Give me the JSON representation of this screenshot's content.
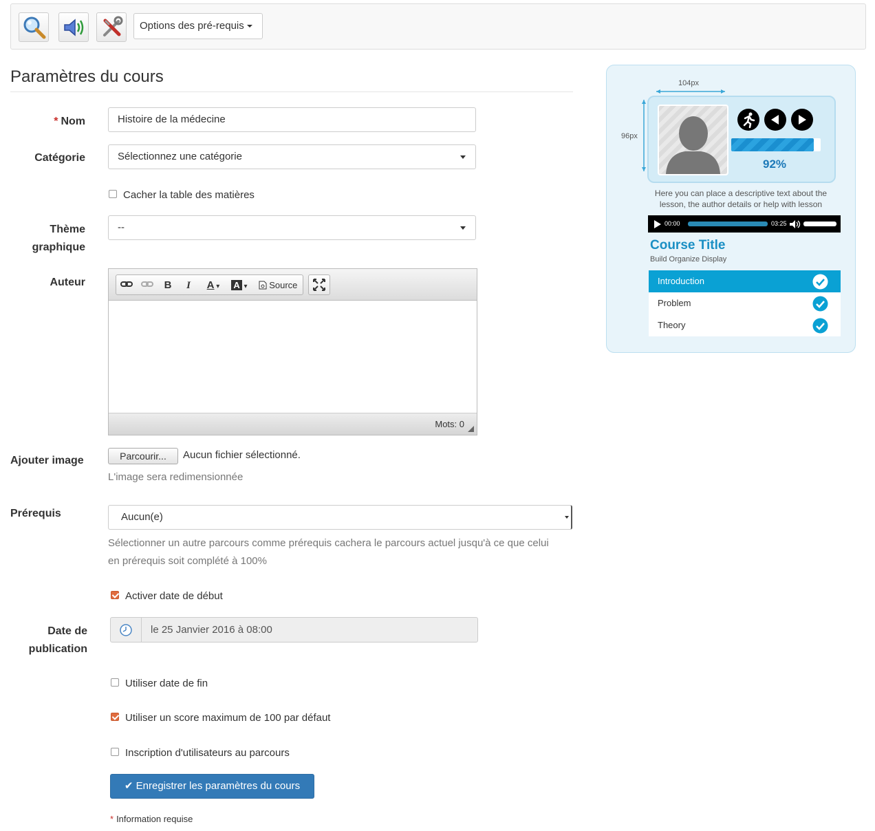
{
  "toolbar": {
    "buttons": [
      {
        "icon": "search-icon"
      },
      {
        "icon": "speaker-icon"
      },
      {
        "icon": "tools-icon"
      }
    ],
    "prereq_options_label": "Options des pré-requis"
  },
  "page_title": "Paramètres du cours",
  "form": {
    "name": {
      "label": "Nom",
      "value": "Histoire de la médecine"
    },
    "category": {
      "label": "Catégorie",
      "value": "Sélectionnez une catégorie"
    },
    "hide_toc": {
      "label": "Cacher la table des matières",
      "checked": false
    },
    "theme": {
      "label_line1": "Thème",
      "label_line2": "graphique",
      "value": "--"
    },
    "author": {
      "label": "Auteur",
      "source_label": "Source",
      "words_label": "Mots: 0"
    },
    "image": {
      "label": "Ajouter image",
      "browse_label": "Parcourir...",
      "no_file": "Aucun fichier sélectionné.",
      "help": "L'image sera redimensionnée"
    },
    "prereq": {
      "label": "Prérequis",
      "value": "Aucun(e)",
      "help_line1": "Sélectionner un autre parcours comme prérequis cachera le parcours actuel jusqu'à ce que celui",
      "help_line2": "en prérequis soit complété à 100%"
    },
    "enable_start_date": {
      "label": "Activer date de début",
      "checked": true
    },
    "publication_date": {
      "label_line1": "Date de",
      "label_line2": "publication",
      "value": "le 25 Janvier 2016 à 08:00"
    },
    "use_end_date": {
      "label": "Utiliser date de fin",
      "checked": false
    },
    "max_score": {
      "label": "Utiliser un score maximum de 100 par défaut",
      "checked": true
    },
    "subscribe_users": {
      "label": "Inscription d'utilisateurs au parcours",
      "checked": false
    },
    "submit_label": "Enregistrer les paramètres du cours",
    "required_note": "Information requise"
  },
  "preview": {
    "width_label": "104px",
    "height_label": "96px",
    "progress_percent": 92,
    "progress_label": "92%",
    "description": "Here you can place a descriptive text about the lesson, the author details or help with lesson",
    "player_start": "00:00",
    "player_end": "03:25",
    "course_title": "Course Title",
    "course_subtitle": "Build Organize Display",
    "items": [
      {
        "label": "Introduction",
        "active": true
      },
      {
        "label": "Problem",
        "active": false
      },
      {
        "label": "Theory",
        "active": false
      }
    ]
  },
  "colors": {
    "primary": "#337ab7",
    "required": "#c9302c",
    "checkbox_checked": "#e06c3e",
    "preview_accent": "#0aa1d4"
  }
}
